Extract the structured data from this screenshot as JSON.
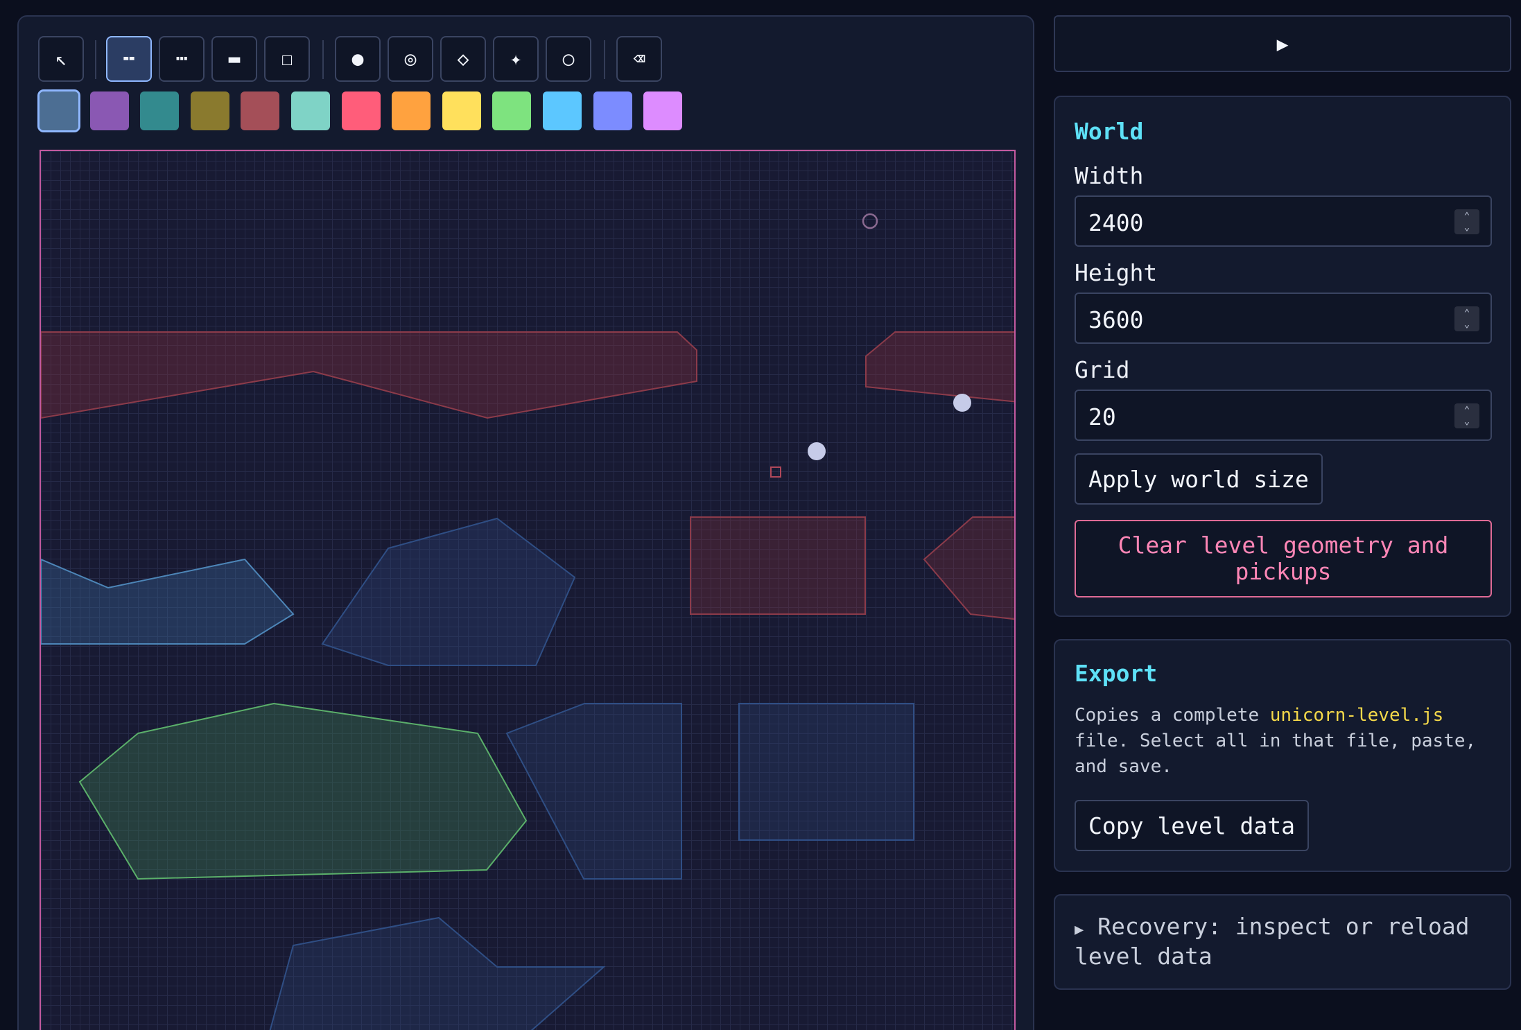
{
  "toolbar": {
    "tools": [
      {
        "icon": "↖",
        "name": "select-tool"
      },
      {
        "icon": "╍",
        "name": "platform-tool"
      },
      {
        "icon": "┅",
        "name": "dashed-platform-tool"
      },
      {
        "icon": "▬",
        "name": "solid-platform-tool"
      },
      {
        "icon": "☐",
        "name": "rectangle-tool"
      },
      {
        "icon": "●",
        "name": "dot-tool"
      },
      {
        "icon": "◎",
        "name": "target-tool"
      },
      {
        "icon": "◇",
        "name": "diamond-tool"
      },
      {
        "icon": "✦",
        "name": "star-tool"
      },
      {
        "icon": "○",
        "name": "circle-tool"
      },
      {
        "icon": "⌫",
        "name": "erase-tool"
      }
    ],
    "active_tool_index": 1
  },
  "palette": {
    "colors": [
      "#4c6e93",
      "#8a58b3",
      "#338a8e",
      "#8a7a2e",
      "#a44f58",
      "#7fd3c6",
      "#ff5d7a",
      "#ffa23f",
      "#ffe05c",
      "#7ee37f",
      "#5cc7ff",
      "#7c8cff",
      "#dd8cff"
    ],
    "active_index": 0
  },
  "play_button": {
    "icon": "▶"
  },
  "world": {
    "title": "World",
    "width_label": "Width",
    "width_value": "2400",
    "height_label": "Height",
    "height_value": "3600",
    "grid_label": "Grid",
    "grid_value": "20",
    "apply_label": "Apply world size",
    "clear_label": "Clear level geometry and pickups"
  },
  "export": {
    "title": "Export",
    "text_before": "Copies a complete ",
    "filename": "unicorn-level.js",
    "text_after": " file. Select all in that file, paste, and save.",
    "copy_label": "Copy level data"
  },
  "recovery": {
    "arrow": "▶",
    "label": "Recovery: inspect or reload level data"
  },
  "colors": {
    "accent": "#5ee1f7",
    "danger": "#ff86b6",
    "highlight": "#f5d94a",
    "canvas_border": "#c45aa0"
  }
}
